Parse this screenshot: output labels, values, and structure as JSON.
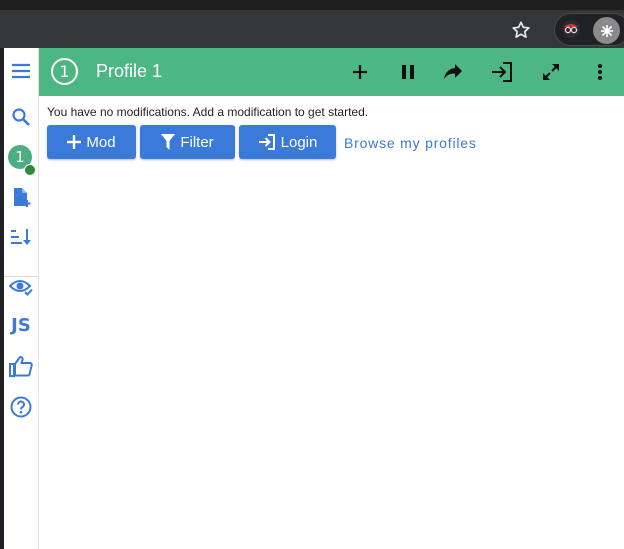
{
  "header": {
    "profile_number": "1",
    "title": "Profile 1"
  },
  "sidebar": {
    "profile_badge": "1",
    "js_label": "JS"
  },
  "main": {
    "empty_message": "You have no modifications. Add a modification to get started.",
    "buttons": {
      "mod": "Mod",
      "filter": "Filter",
      "login": "Login"
    },
    "browse_link": "Browse my profiles"
  },
  "colors": {
    "header": "#4db784",
    "button": "#3b7ad9",
    "sidebar_icon": "#3b7ad9"
  }
}
